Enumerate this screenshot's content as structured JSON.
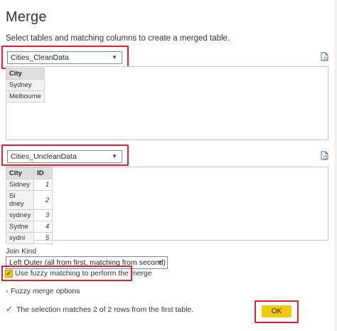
{
  "dialog": {
    "title": "Merge",
    "subtitle": "Select tables and matching columns to create a merged table."
  },
  "first_table": {
    "selected": "Cities_CleanData",
    "columns": [
      "City"
    ],
    "rows": [
      [
        "Sydney"
      ],
      [
        "Melbourne"
      ]
    ]
  },
  "second_table": {
    "selected": "Cities_UncleanData",
    "columns": [
      "City",
      "ID"
    ],
    "rows": [
      [
        "Sidney",
        "1"
      ],
      [
        "Si dney",
        "2"
      ],
      [
        "sydney",
        "3"
      ],
      [
        "Sydne",
        "4"
      ],
      [
        "sydni",
        "5"
      ]
    ]
  },
  "join": {
    "label": "Join Kind",
    "selected": "Left Outer (all from first, matching from second)"
  },
  "fuzzy": {
    "checkbox_label": "Use fuzzy matching to perform the merge",
    "checked": true,
    "options_label": "Fuzzy merge options"
  },
  "status": {
    "message": "The selection matches 2 of 2 rows from the first table."
  },
  "buttons": {
    "ok": "OK"
  },
  "icons": {
    "refresh": "refresh-icon",
    "check": "checkmark-icon",
    "chevron": "chevron-right-icon",
    "dropdown": "chevron-down-icon"
  },
  "colors": {
    "highlight": "#e0202c",
    "accent": "#f2c811",
    "success": "#107c10"
  }
}
